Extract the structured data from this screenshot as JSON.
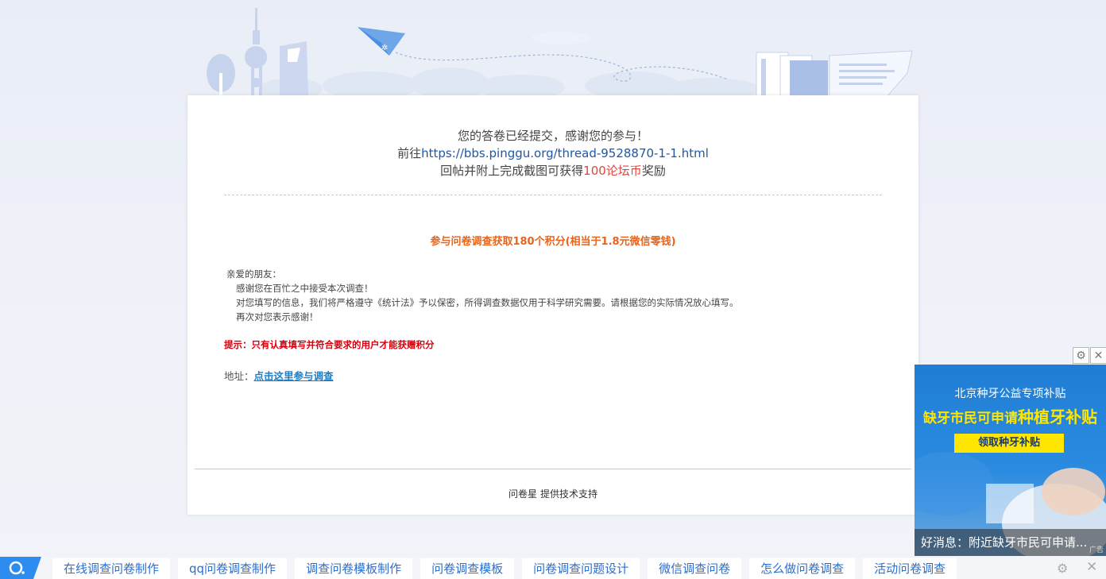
{
  "message": {
    "line1": "您的答卷已经提交，感谢您的参与！",
    "line2_prefix": "前往",
    "line2_link": "https://bbs.pinggu.org/thread-9528870-1-1.html",
    "line3_prefix": "回帖并附上完成截图可获得",
    "line3_highlight": "100论坛币",
    "line3_suffix": "奖励"
  },
  "promo": "参与问卷调查获取180个积分(相当于1.8元微信零钱)",
  "letter": {
    "greeting": "亲爱的朋友：",
    "line1": "感谢您在百忙之中接受本次调查！",
    "line2": "对您填写的信息，我们将严格遵守《统计法》予以保密，所得调查数据仅用于科学研究需要。请根据您的实际情况放心填写。",
    "line3": "再次对您表示感谢！"
  },
  "tip": "提示：只有认真填写并符合要求的用户才能获赠积分",
  "address": {
    "label": "地址：",
    "link": "点击这里参与调查"
  },
  "footer": {
    "brand": "问卷星",
    "text": "提供技术支持"
  },
  "ad": {
    "title": "北京种牙公益专项补贴",
    "subtitle_prefix": "缺牙市民可申请",
    "subtitle_big": "种植牙补贴",
    "button": "领取种牙补贴",
    "caption": "好消息：附近缺牙市民可申请...",
    "label": "广告"
  },
  "bottom_links": [
    "在线调查问卷制作",
    "qq问卷调查制作",
    "调查问卷模板制作",
    "问卷调查模板",
    "问卷调查问题设计",
    "微信调查问卷",
    "怎么做问卷调查",
    "活动问卷调查"
  ],
  "colors": {
    "link_blue": "#1f57a6",
    "highlight_red": "#e0453a",
    "promo_orange": "#e8641b",
    "tip_red": "#d9000d",
    "ad_yellow": "#ffe600"
  }
}
